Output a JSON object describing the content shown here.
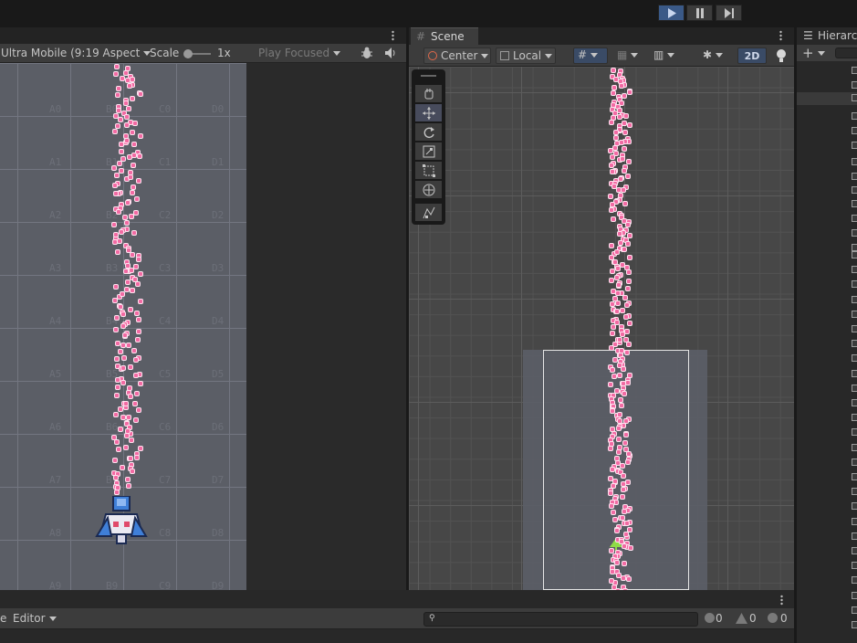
{
  "toolbar": {
    "play_icon": "play-icon",
    "pause_icon": "pause-icon",
    "step_icon": "step-icon",
    "play_active": true
  },
  "game": {
    "aspect": "Ultra Mobile (9:19 Aspect",
    "scale_label": "Scale",
    "scale_value": "1x",
    "play_mode": "Play Focused",
    "tiles": [
      [
        "A0",
        "B0",
        "C0",
        "D0"
      ],
      [
        "A1",
        "B1",
        "C1",
        "D1"
      ],
      [
        "A2",
        "B2",
        "C2",
        "D2"
      ],
      [
        "A3",
        "B3",
        "C3",
        "D3"
      ],
      [
        "A4",
        "B4",
        "C4",
        "D4"
      ],
      [
        "A5",
        "B5",
        "C5",
        "D5"
      ],
      [
        "A6",
        "B6",
        "C6",
        "D6"
      ],
      [
        "A7",
        "B7",
        "C7",
        "D7"
      ],
      [
        "A8",
        "B8",
        "C8",
        "D8"
      ],
      [
        "A9",
        "B9",
        "C9",
        "D9"
      ]
    ]
  },
  "scene": {
    "tab": "Scene",
    "pivot": "Center",
    "space": "Local",
    "mode_2d": "2D"
  },
  "hierarchy": {
    "tab": "Hierarc"
  },
  "console": {
    "clear_partial": "e",
    "editor": "Editor",
    "search_placeholder": "",
    "info_count": "0",
    "warn_count": "0",
    "error_count": "0"
  },
  "colors": {
    "accent_play": "#3a5987",
    "bullet_pink": "#f26aa3",
    "ship_blue": "#3f7fd8"
  }
}
